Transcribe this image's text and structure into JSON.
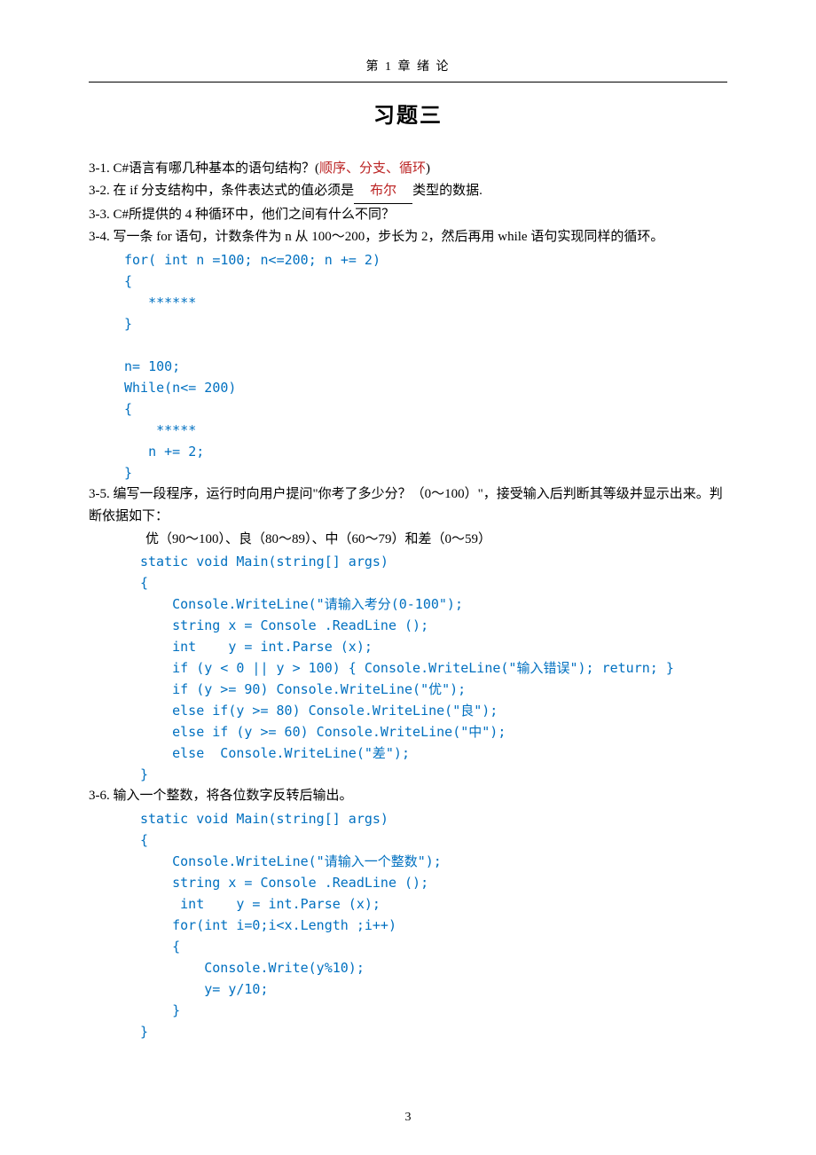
{
  "header": "第 1 章  绪  论",
  "title": "习题三",
  "q1": {
    "num": "3-1.",
    "text": "C#语言有哪几种基本的语句结构？(",
    "answer": "顺序、分支、循环",
    "close": ")"
  },
  "q2": {
    "num": "3-2.",
    "text_a": "在 if 分支结构中，条件表达式的值必须是",
    "blank": "  布尔  ",
    "text_b": "类型的数据."
  },
  "q3": {
    "num": "3-3.",
    "text": "C#所提供的 4 种循环中，他们之间有什么不同？"
  },
  "q4": {
    "num": "3-4.",
    "text": " 写一条 for 语句，计数条件为 n 从 100～200，步长为 2，然后再用 while 语句实现同样的循环。",
    "code": "for( int n =100; n<=200; n += 2)\n{\n   ******\n}\n\nn= 100;\nWhile(n<= 200)\n{\n    *****\n   n += 2;\n}"
  },
  "q5": {
    "num": "3-5.",
    "text": "编写一段程序，运行时向用户提问\"你考了多少分？（0～100）\"，接受输入后判断其等级并显示出来。判断依据如下：",
    "criteria": "优（90～100）、良（80～89）、中（60～79）和差（0～59）",
    "code": "static void Main(string[] args)\n{\n    Console.WriteLine(\"请输入考分(0-100\");\n    string x = Console .ReadLine ();\n    int    y = int.Parse (x);\n    if (y < 0 || y > 100) { Console.WriteLine(\"输入错误\"); return; }\n    if (y >= 90) Console.WriteLine(\"优\");\n    else if(y >= 80) Console.WriteLine(\"良\");\n    else if (y >= 60) Console.WriteLine(\"中\");\n    else  Console.WriteLine(\"差\");\n}"
  },
  "q6": {
    "num": "3-6.",
    "text": "输入一个整数，将各位数字反转后输出。",
    "code": "static void Main(string[] args)\n{\n    Console.WriteLine(\"请输入一个整数\");\n    string x = Console .ReadLine ();\n     int    y = int.Parse (x);\n    for(int i=0;i<x.Length ;i++)\n    {\n        Console.Write(y%10);\n        y= y/10;\n    }\n}"
  },
  "page_number": "3"
}
